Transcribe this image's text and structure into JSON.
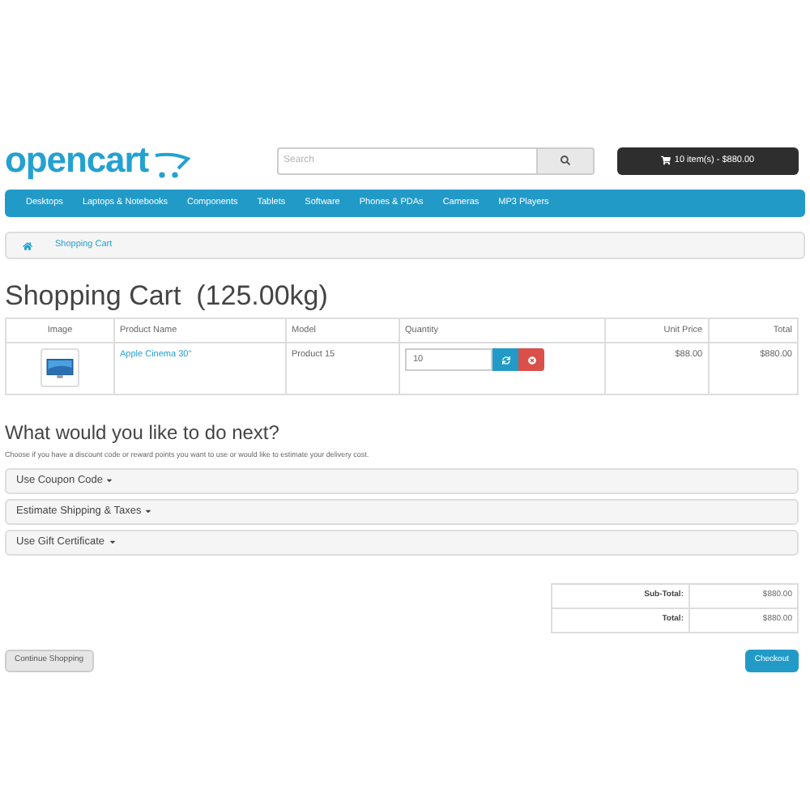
{
  "logo": {
    "text": "opencart"
  },
  "search": {
    "placeholder": "Search"
  },
  "cart_button": {
    "label": "10 item(s) - $880.00"
  },
  "menu": [
    "Desktops",
    "Laptops & Notebooks",
    "Components",
    "Tablets",
    "Software",
    "Phones & PDAs",
    "Cameras",
    "MP3 Players"
  ],
  "breadcrumb": [
    {
      "kind": "home"
    },
    {
      "kind": "link",
      "label": "Shopping Cart"
    }
  ],
  "title": "Shopping Cart  (125.00kg)",
  "cart_table": {
    "columns": [
      "Image",
      "Product Name",
      "Model",
      "Quantity",
      "Unit Price",
      "Total"
    ],
    "rows": [
      {
        "name": "Apple Cinema 30\"",
        "model": "Product 15",
        "quantity": "10",
        "unit_price": "$88.00",
        "total": "$880.00"
      }
    ]
  },
  "next": {
    "heading": "What would you like to do next?",
    "text": "Choose if you have a discount code or reward points you want to use or would like to estimate your delivery cost.",
    "panels": [
      "Use Coupon Code",
      "Estimate Shipping & Taxes",
      "Use Gift Certificate"
    ]
  },
  "totals": [
    {
      "label": "Sub-Total:",
      "value": "$880.00"
    },
    {
      "label": "Total:",
      "value": "$880.00"
    }
  ],
  "buttons": {
    "continue": "Continue Shopping",
    "checkout": "Checkout"
  }
}
